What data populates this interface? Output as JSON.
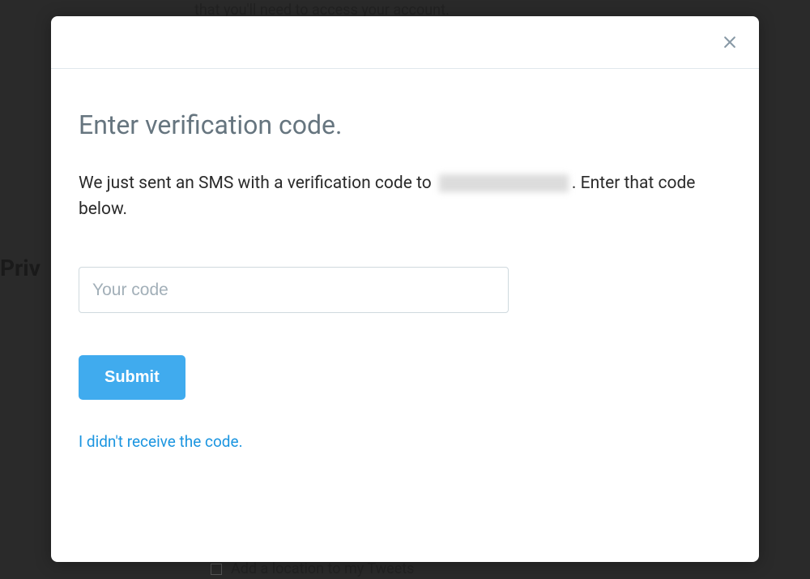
{
  "background": {
    "top_text": "that you'll need to access your account.",
    "left_text": "Priv",
    "bottom_text": "Add a location to my Tweets"
  },
  "modal": {
    "title": "Enter verification code.",
    "description_pre": "We just sent an SMS with a verification code to ",
    "description_post": ". Enter that code below.",
    "input_placeholder": "Your code",
    "submit_label": "Submit",
    "resend_label": "I didn't receive the code."
  }
}
